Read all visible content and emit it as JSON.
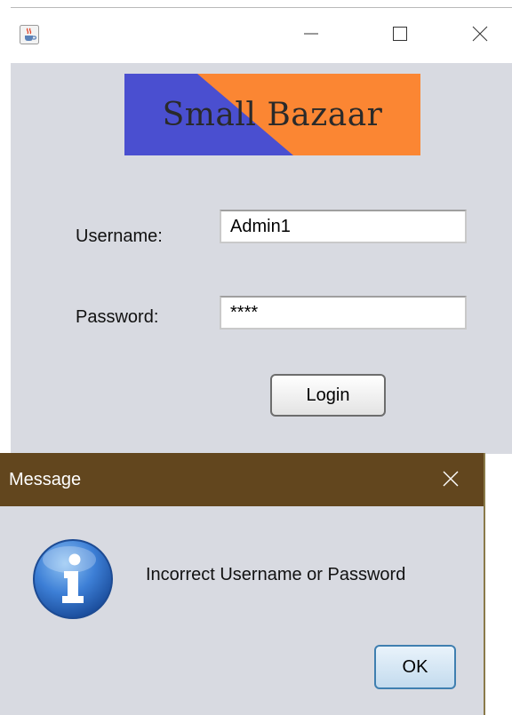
{
  "main_window": {
    "app_icon": "java-cup-icon",
    "controls": {
      "minimize_icon": "minimize-icon",
      "maximize_icon": "maximize-icon",
      "close_icon": "close-icon"
    },
    "logo": {
      "text": "Small Bazaar",
      "colors": {
        "left": "#4a4fd0",
        "right": "#fb8633"
      }
    },
    "form": {
      "username_label": "Username:",
      "username_value": "Admin1",
      "password_label": "Password:",
      "password_value": "****",
      "login_label": "Login"
    }
  },
  "dialog": {
    "title": "Message",
    "close_icon": "close-icon",
    "icon": "info-icon",
    "message": "Incorrect Username or Password",
    "ok_label": "OK",
    "colors": {
      "titlebar": "#62461e",
      "body": "#d8dae1"
    }
  }
}
